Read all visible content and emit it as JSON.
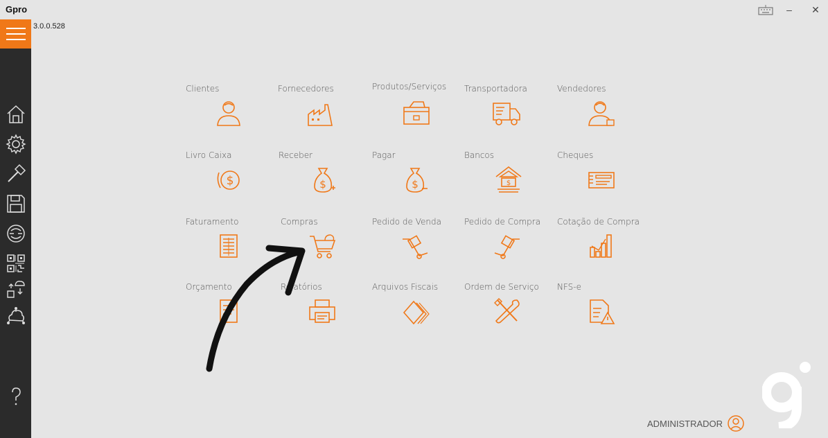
{
  "window": {
    "title": "Gpro",
    "keyboard_icon": "keyboard-icon",
    "minimize_label": "–",
    "close_label": "✕"
  },
  "app": {
    "version": "3.0.0.528",
    "accent_color": "#f07818",
    "sidebar_color": "#2b2b2b"
  },
  "sidebar": {
    "icons": [
      "menu-icon",
      "home-icon",
      "gear-icon",
      "hammer-icon",
      "save-icon",
      "sync-icon",
      "qr-code-icon",
      "cloud-transfer-icon",
      "network-icon",
      "help-icon"
    ]
  },
  "tiles": [
    {
      "label": "Clientes",
      "icon": "person-icon"
    },
    {
      "label": "Fornecedores",
      "icon": "factory-icon"
    },
    {
      "label": "Produtos/Serviços",
      "icon": "box-icon"
    },
    {
      "label": "Transportadora",
      "icon": "truck-icon"
    },
    {
      "label": "Vendedores",
      "icon": "salesperson-icon"
    },
    {
      "label": "Livro Caixa",
      "icon": "cash-cycle-icon"
    },
    {
      "label": "Receber",
      "icon": "money-bag-plus-icon"
    },
    {
      "label": "Pagar",
      "icon": "money-bag-minus-icon"
    },
    {
      "label": "Bancos",
      "icon": "bank-icon"
    },
    {
      "label": "Cheques",
      "icon": "check-icon"
    },
    {
      "label": "Faturamento",
      "icon": "invoice-icon"
    },
    {
      "label": "Compras",
      "icon": "shopping-cart-icon"
    },
    {
      "label": "Pedido de Venda",
      "icon": "hand-truck-icon"
    },
    {
      "label": "Pedido de Compra",
      "icon": "hand-truck-icon"
    },
    {
      "label": "Cotação de Compra",
      "icon": "bar-chart-icon"
    },
    {
      "label": "Orçamento",
      "icon": "document-icon"
    },
    {
      "label": "Relatórios",
      "icon": "printer-icon"
    },
    {
      "label": "Arquivos Fiscais",
      "icon": "files-icon"
    },
    {
      "label": "Ordem de Serviço",
      "icon": "tools-icon"
    },
    {
      "label": "NFS-e",
      "icon": "document-warning-icon"
    }
  ],
  "user": {
    "name": "ADMINISTRADOR",
    "icon": "user-circle-icon"
  },
  "overlay": {
    "annotation": "arrow-annotation"
  }
}
